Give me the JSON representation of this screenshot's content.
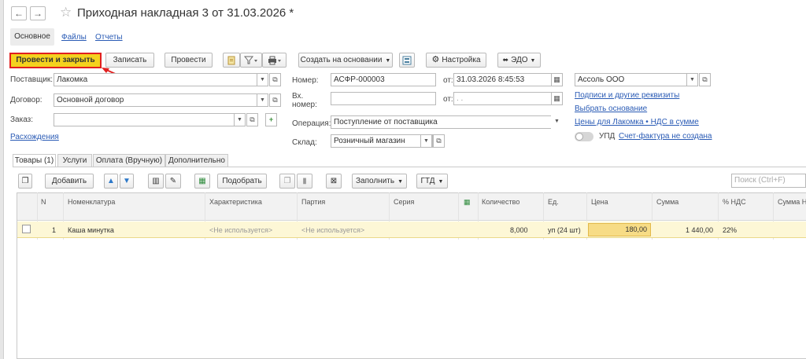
{
  "window": {
    "title": "Приходная накладная 3 от 31.03.2026 *"
  },
  "nav": {
    "back": "←",
    "forward": "→",
    "star": "☆"
  },
  "top_tabs": [
    {
      "label": "Основное"
    },
    {
      "label": "Файлы"
    },
    {
      "label": "Отчеты"
    }
  ],
  "toolbar": {
    "post_and_close": "Провести и закрыть",
    "save": "Записать",
    "post": "Провести",
    "create_based_on": "Создать на основании",
    "settings": "Настройка",
    "edo": "ЭДО"
  },
  "form": {
    "supplier_label": "Поставщик:",
    "supplier_value": "Лакомка",
    "contract_label": "Договор:",
    "contract_value": "Основной договор",
    "order_label": "Заказ:",
    "order_value": "",
    "discrepancies_link": "Расхождения",
    "number_label": "Номер:",
    "number_value": "АСФР-000003",
    "date_label": "от:",
    "date_value": "31.03.2026  8:45:53",
    "in_number_label_1": "Вх.",
    "in_number_label_2": "номер:",
    "in_number_value": "",
    "in_date_label": "от:",
    "in_date_value": " .  .",
    "operation_label": "Операция:",
    "operation_value": "Поступление от поставщика",
    "warehouse_label": "Склад:",
    "warehouse_value": "Розничный магазин",
    "organization_value": "Ассоль ООО",
    "links": [
      "Подписи и другие реквизиты",
      "Выбрать основание",
      "Цены для Лакомка • НДС в сумме"
    ],
    "upd_label": "УПД",
    "invoice_link": "Счет-фактура не создана"
  },
  "tabs": [
    {
      "label": "Товары (1)"
    },
    {
      "label": "Услуги"
    },
    {
      "label": "Оплата (Вручную)"
    },
    {
      "label": "Дополнительно"
    }
  ],
  "table_toolbar": {
    "add": "Добавить",
    "pick": "Подобрать",
    "fill": "Заполнить",
    "gtd": "ГТД",
    "search_placeholder": "Поиск (Ctrl+F)"
  },
  "table": {
    "headers": [
      "N",
      "Номенклатура",
      "Характеристика",
      "Партия",
      "Серия",
      "Количество",
      "Ед.",
      "Цена",
      "Сумма",
      "% НДС",
      "Сумма Н"
    ],
    "rows": [
      {
        "n": "1",
        "item": "Каша минутка",
        "characteristic": "<Не используется>",
        "batch": "<Не используется>",
        "series": "",
        "quantity": "8,000",
        "unit": "уп (24 шт)",
        "price": "180,00",
        "sum": "1 440,00",
        "vat": "22%"
      }
    ]
  },
  "colors": {
    "primary_button": "#f4d21e",
    "annotation_red": "#e11f1f",
    "link": "#2a5bb5",
    "selected_row": "#fdf7d6"
  }
}
